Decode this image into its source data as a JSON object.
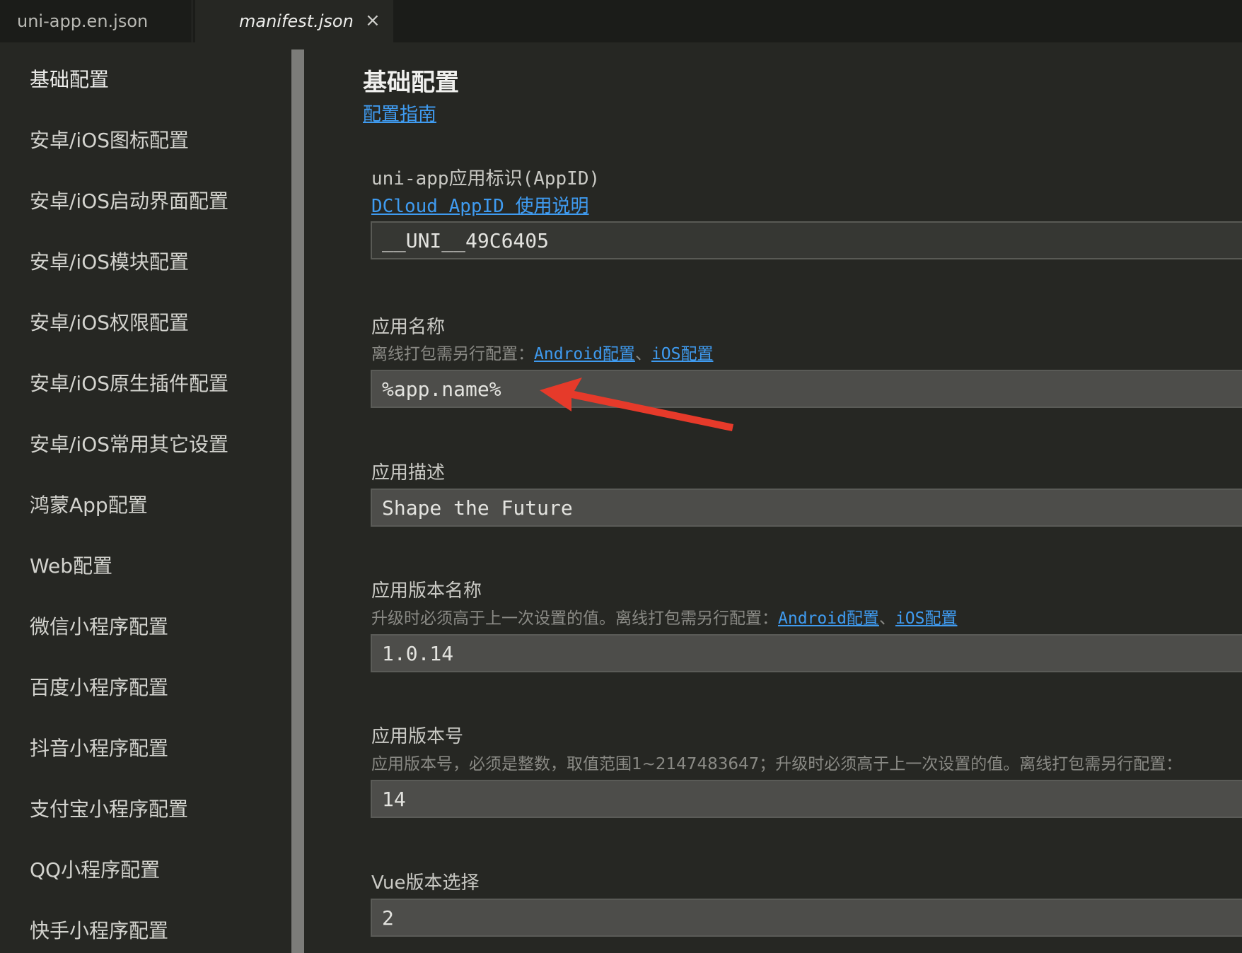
{
  "tabs": [
    {
      "label": "uni-app.en.json"
    },
    {
      "label": "manifest.json",
      "close": "×"
    }
  ],
  "sidebar": {
    "items": [
      {
        "label": "基础配置"
      },
      {
        "label": "安卓/iOS图标配置"
      },
      {
        "label": "安卓/iOS启动界面配置"
      },
      {
        "label": "安卓/iOS模块配置"
      },
      {
        "label": "安卓/iOS权限配置"
      },
      {
        "label": "安卓/iOS原生插件配置"
      },
      {
        "label": "安卓/iOS常用其它设置"
      },
      {
        "label": "鸿蒙App配置"
      },
      {
        "label": "Web配置"
      },
      {
        "label": "微信小程序配置"
      },
      {
        "label": "百度小程序配置"
      },
      {
        "label": "抖音小程序配置"
      },
      {
        "label": "支付宝小程序配置"
      },
      {
        "label": "QQ小程序配置"
      },
      {
        "label": "快手小程序配置"
      }
    ]
  },
  "main": {
    "title": "基础配置",
    "guide_link": "配置指南",
    "appid": {
      "label": "uni-app应用标识(AppID)",
      "link": "DCloud AppID 使用说明",
      "value": "__UNI__49C6405"
    },
    "app_name": {
      "label": "应用名称",
      "hint": "离线打包需另行配置：",
      "android_link": "Android配置",
      "sep": "、",
      "ios_link": "iOS配置",
      "value": "%app.name%"
    },
    "app_desc": {
      "label": "应用描述",
      "value": "Shape the Future"
    },
    "version_name": {
      "label": "应用版本名称",
      "hint": "升级时必须高于上一次设置的值。离线打包需另行配置：",
      "android_link": "Android配置",
      "sep": "、",
      "ios_link": "iOS配置",
      "value": "1.0.14"
    },
    "version_code": {
      "label": "应用版本号",
      "hint": "应用版本号，必须是整数，取值范围1~2147483647；升级时必须高于上一次设置的值。离线打包需另行配置：",
      "value": "14"
    },
    "vue_version": {
      "label": "Vue版本选择",
      "value": "2"
    }
  },
  "colors": {
    "background": "#262723",
    "link": "#3f9bf0",
    "annotation_arrow": "#e63a2a"
  }
}
